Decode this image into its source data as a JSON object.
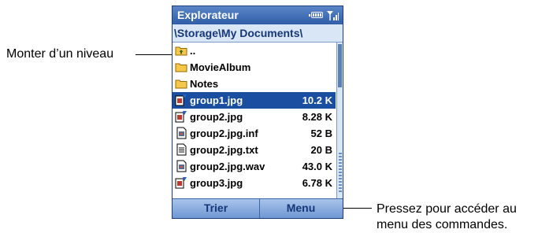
{
  "callouts": {
    "up_level": "Monter d’un niveau",
    "menu_hint_line1": "Pressez pour accéder au",
    "menu_hint_line2": "menu des commandes."
  },
  "app": {
    "title": "Explorateur",
    "path": "\\Storage\\My Documents\\"
  },
  "files": [
    {
      "name": "..",
      "size": "",
      "icon": "folder-up-icon"
    },
    {
      "name": "MovieAlbum",
      "size": "",
      "icon": "folder-icon"
    },
    {
      "name": "Notes",
      "size": "",
      "icon": "folder-icon"
    },
    {
      "name": "group1.jpg",
      "size": "10.2 K",
      "icon": "image-file-icon",
      "selected": true
    },
    {
      "name": "group2.jpg",
      "size": "8.28 K",
      "icon": "image-file-icon"
    },
    {
      "name": "group2.jpg.inf",
      "size": "52 B",
      "icon": "generic-file-icon"
    },
    {
      "name": "group2.jpg.txt",
      "size": "20 B",
      "icon": "text-file-icon"
    },
    {
      "name": "group2.jpg.wav",
      "size": "43.0 K",
      "icon": "generic-file-icon"
    },
    {
      "name": "group3.jpg",
      "size": "6.78 K",
      "icon": "image-file-icon"
    }
  ],
  "softkeys": {
    "left": "Trier",
    "right": "Menu"
  },
  "colors": {
    "titlebar": "#2f5ea8",
    "selection": "#1a4ea1",
    "softkeys": "#6f97d3"
  }
}
